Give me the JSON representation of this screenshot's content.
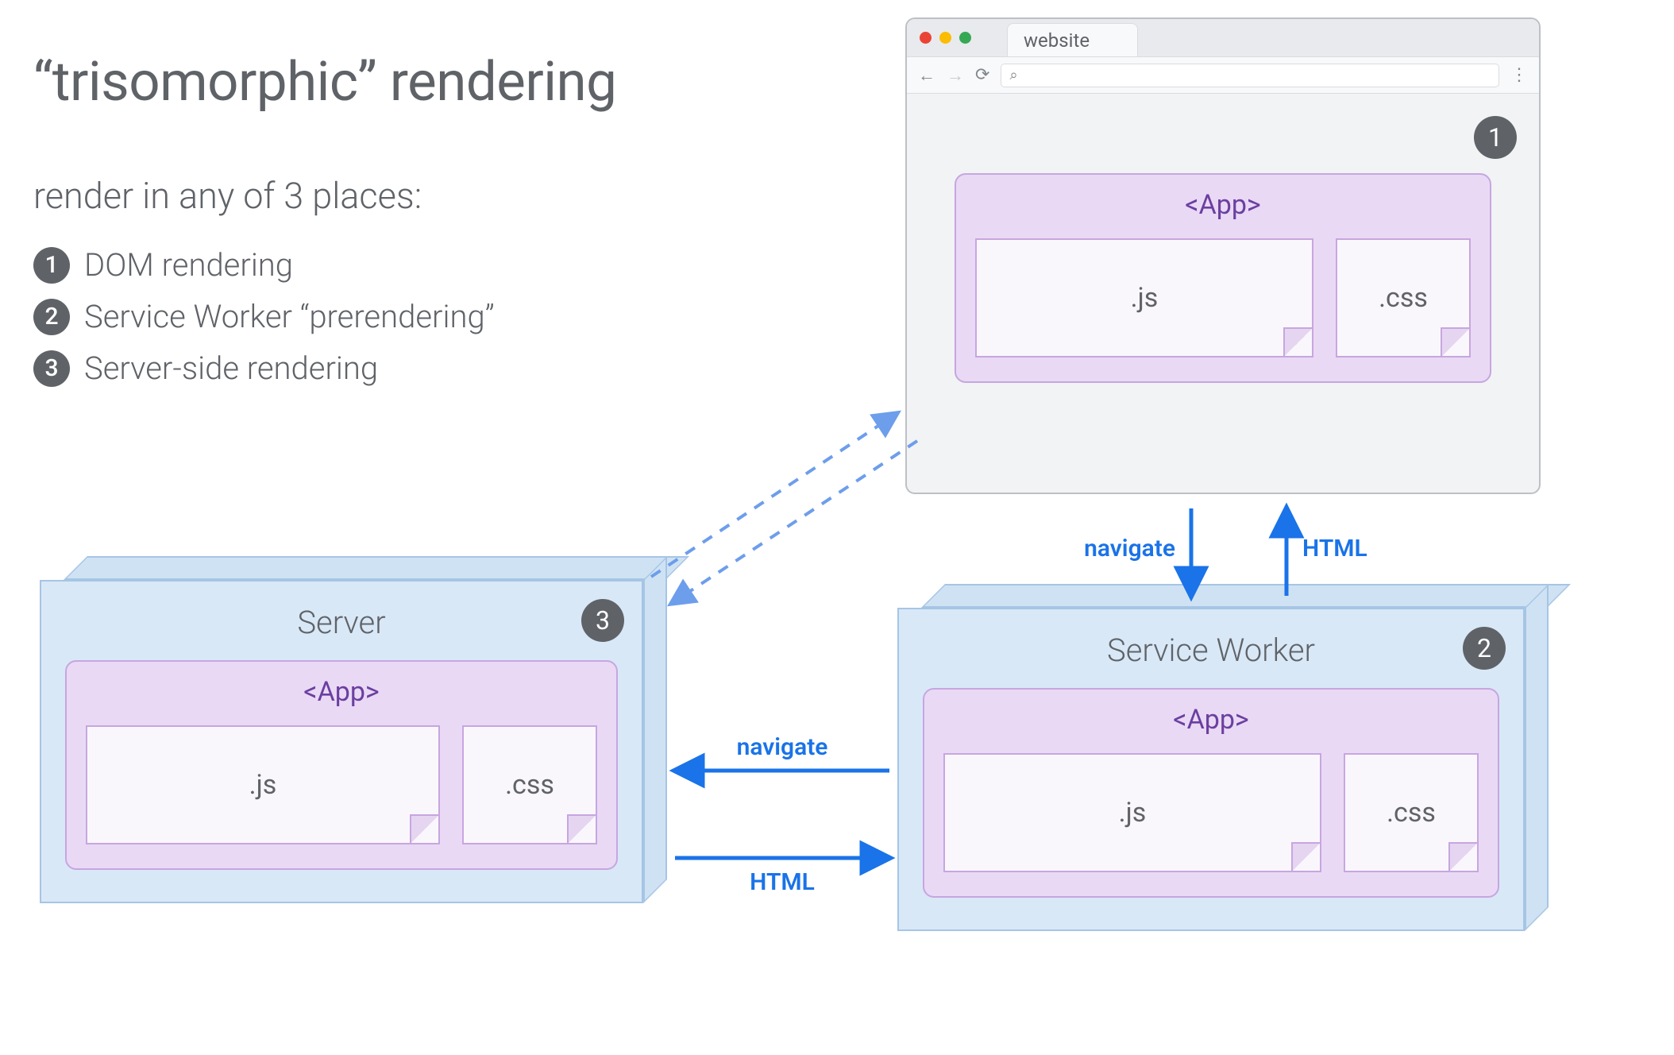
{
  "title": "“trisomorphic” rendering",
  "subtitle": "render in any of 3 places:",
  "legend": [
    {
      "num": "1",
      "label": "DOM rendering"
    },
    {
      "num": "2",
      "label": "Service Worker “prerendering”"
    },
    {
      "num": "3",
      "label": "Server-side rendering"
    }
  ],
  "browser": {
    "tab_label": "website",
    "badge": "1",
    "app_label": "<App>",
    "files": {
      "js": ".js",
      "css": ".css"
    }
  },
  "server": {
    "title": "Server",
    "badge": "3",
    "app_label": "<App>",
    "files": {
      "js": ".js",
      "css": ".css"
    }
  },
  "worker": {
    "title": "Service Worker",
    "badge": "2",
    "app_label": "<App>",
    "files": {
      "js": ".js",
      "css": ".css"
    }
  },
  "arrows": {
    "browser_worker_down": "navigate",
    "browser_worker_up": "HTML",
    "worker_server_left": "navigate",
    "worker_server_right": "HTML"
  },
  "colors": {
    "text": "#5f6368",
    "arrow": "#1a73e8",
    "box_fill": "#d9e8f7",
    "box_border": "#a6c5e5",
    "app_fill": "#e9d9f5",
    "app_border": "#c7a6e0",
    "app_text": "#6b3fa0"
  }
}
